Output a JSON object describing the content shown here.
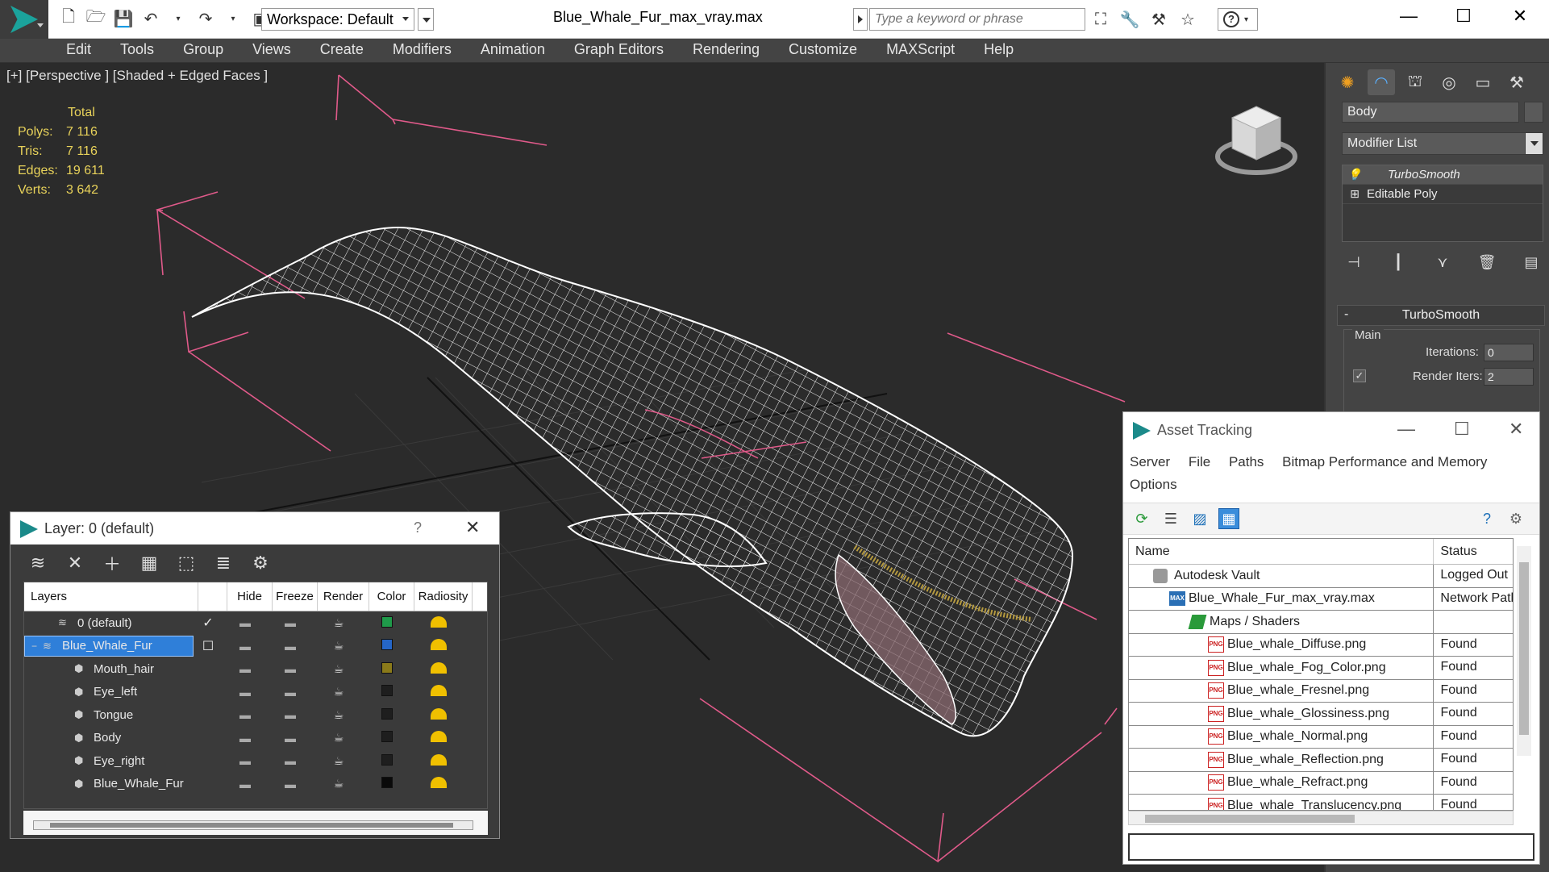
{
  "titlebar": {
    "workspace": "Workspace: Default",
    "document_title": "Blue_Whale_Fur_max_vray.max",
    "search_placeholder": "Type a keyword or phrase",
    "minimize": "—",
    "maximize": "☐",
    "close": "✕"
  },
  "menu": [
    "Edit",
    "Tools",
    "Group",
    "Views",
    "Create",
    "Modifiers",
    "Animation",
    "Graph Editors",
    "Rendering",
    "Customize",
    "MAXScript",
    "Help"
  ],
  "viewport": {
    "label": "[+] [Perspective ] [Shaded + Edged Faces ]",
    "stats": {
      "header": "Total",
      "rows": [
        {
          "k": "Polys:",
          "v": "7 116"
        },
        {
          "k": "Tris:",
          "v": "7 116"
        },
        {
          "k": "Edges:",
          "v": "19 611"
        },
        {
          "k": "Verts:",
          "v": "3 642"
        }
      ]
    }
  },
  "command_panel": {
    "object_name": "Body",
    "modifier_list": "Modifier List",
    "stack": [
      {
        "label": "TurboSmooth",
        "selected": true
      },
      {
        "label": "Editable Poly",
        "selected": false
      }
    ],
    "rollout_title": "TurboSmooth",
    "rollout_minus": "-",
    "group_main": "Main",
    "iterations_label": "Iterations:",
    "iterations_value": "0",
    "render_iters_label": "Render Iters:",
    "render_iters_value": "2",
    "render_iters_check": "✓"
  },
  "layer_dialog": {
    "title": "Layer: 0 (default)",
    "help": "?",
    "close": "✕",
    "columns": [
      "Layers",
      "",
      "Hide",
      "Freeze",
      "Render",
      "Color",
      "Radiosity"
    ],
    "rows": [
      {
        "name": "0 (default)",
        "indent": 1,
        "current": "✓",
        "color": "#1f9a4a",
        "selected": false,
        "expander": ""
      },
      {
        "name": "Blue_Whale_Fur",
        "indent": 0,
        "current": "☐",
        "color": "#2566c8",
        "selected": true,
        "expander": "−"
      },
      {
        "name": "Mouth_hair",
        "indent": 2,
        "current": "",
        "color": "#8a7a1a",
        "selected": false,
        "expander": ""
      },
      {
        "name": "Eye_left",
        "indent": 2,
        "current": "",
        "color": "#1e1e1e",
        "selected": false,
        "expander": ""
      },
      {
        "name": "Tongue",
        "indent": 2,
        "current": "",
        "color": "#1e1e1e",
        "selected": false,
        "expander": ""
      },
      {
        "name": "Body",
        "indent": 2,
        "current": "",
        "color": "#1e1e1e",
        "selected": false,
        "expander": ""
      },
      {
        "name": "Eye_right",
        "indent": 2,
        "current": "",
        "color": "#1e1e1e",
        "selected": false,
        "expander": ""
      },
      {
        "name": "Blue_Whale_Fur",
        "indent": 2,
        "current": "",
        "color": "#0a0a0a",
        "selected": false,
        "expander": ""
      }
    ]
  },
  "asset_dialog": {
    "title": "Asset Tracking",
    "min": "—",
    "max": "☐",
    "close": "✕",
    "menu": [
      "Server",
      "File",
      "Paths",
      "Bitmap Performance and Memory",
      "Options"
    ],
    "col_name": "Name",
    "col_status": "Status",
    "rows": [
      {
        "name": "Autodesk Vault",
        "status": "Logged Out",
        "icon": "vault",
        "indent": 40
      },
      {
        "name": "Blue_Whale_Fur_max_vray.max",
        "status": "Network Path",
        "icon": "max",
        "indent": 60
      },
      {
        "name": "Maps / Shaders",
        "status": "",
        "icon": "maps",
        "indent": 86
      },
      {
        "name": "Blue_whale_Diffuse.png",
        "status": "Found",
        "icon": "png",
        "indent": 108
      },
      {
        "name": "Blue_whale_Fog_Color.png",
        "status": "Found",
        "icon": "png",
        "indent": 108
      },
      {
        "name": "Blue_whale_Fresnel.png",
        "status": "Found",
        "icon": "png",
        "indent": 108
      },
      {
        "name": "Blue_whale_Glossiness.png",
        "status": "Found",
        "icon": "png",
        "indent": 108
      },
      {
        "name": "Blue_whale_Normal.png",
        "status": "Found",
        "icon": "png",
        "indent": 108
      },
      {
        "name": "Blue_whale_Reflection.png",
        "status": "Found",
        "icon": "png",
        "indent": 108
      },
      {
        "name": "Blue_whale_Refract.png",
        "status": "Found",
        "icon": "png",
        "indent": 108
      },
      {
        "name": "Blue_whale_Translucency.png",
        "status": "Found",
        "icon": "png",
        "indent": 108
      }
    ]
  },
  "colors": {
    "stats_yellow": "#e8d25a",
    "selection_blue": "#2f7fd9",
    "gizmo_pink": "#e05a8a",
    "accent_teal": "#1ba39c"
  }
}
